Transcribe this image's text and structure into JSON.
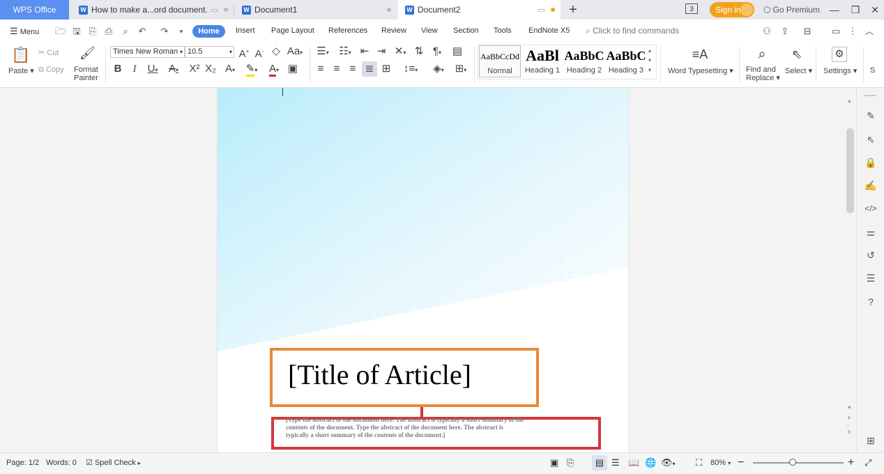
{
  "tabs": {
    "app": "WPS Office",
    "doc0": "How to make a...ord document.",
    "doc1": "Document1",
    "doc2": "Document2"
  },
  "titlebar": {
    "badge": "3",
    "sign_in": "Sign in",
    "premium": "Go Premium"
  },
  "menu": {
    "menu_label": "Menu",
    "items": [
      "Home",
      "Insert",
      "Page Layout",
      "References",
      "Review",
      "View",
      "Section",
      "Tools",
      "EndNote X5"
    ],
    "search_placeholder": "Click to find commands"
  },
  "ribbon": {
    "paste": "Paste",
    "cut": "Cut",
    "copy": "Copy",
    "format_painter_1": "Format",
    "format_painter_2": "Painter",
    "font_name": "Times New Roman",
    "font_size": "10.5",
    "styles": [
      {
        "preview": "AaBbCcDd",
        "name": "Normal"
      },
      {
        "preview": "AaBl",
        "name": "Heading 1"
      },
      {
        "preview": "AaBbC",
        "name": "Heading 2"
      },
      {
        "preview": "AaBbC",
        "name": "Heading 3"
      }
    ],
    "word_typesetting": "Word Typesetting",
    "find_replace_1": "Find and",
    "find_replace_2": "Replace",
    "select": "Select",
    "settings": "Settings",
    "cut_off": "S"
  },
  "document": {
    "title": "[Title of Article]",
    "abstract_line1": "[Type the abstract of the document here. The abstract is typically a short summary of the",
    "abstract_line2": "contents of the document. Type the abstract of the document here. The abstract is",
    "abstract_line3": "typically a short summary of the contents of the document.]"
  },
  "statusbar": {
    "page": "Page: 1/2",
    "words": "Words: 0",
    "spell_check": "Spell Check",
    "zoom": "80%",
    "zoom_level": 0.8
  },
  "colors": {
    "tab_app_bg": "#5b8ff0",
    "home_pill": "#4a86e8",
    "sign_in": "#f2a21a",
    "title_box_border": "#e8893a",
    "abstract_box_border": "#d9343a",
    "page_gradient": "#b9ecfc"
  }
}
